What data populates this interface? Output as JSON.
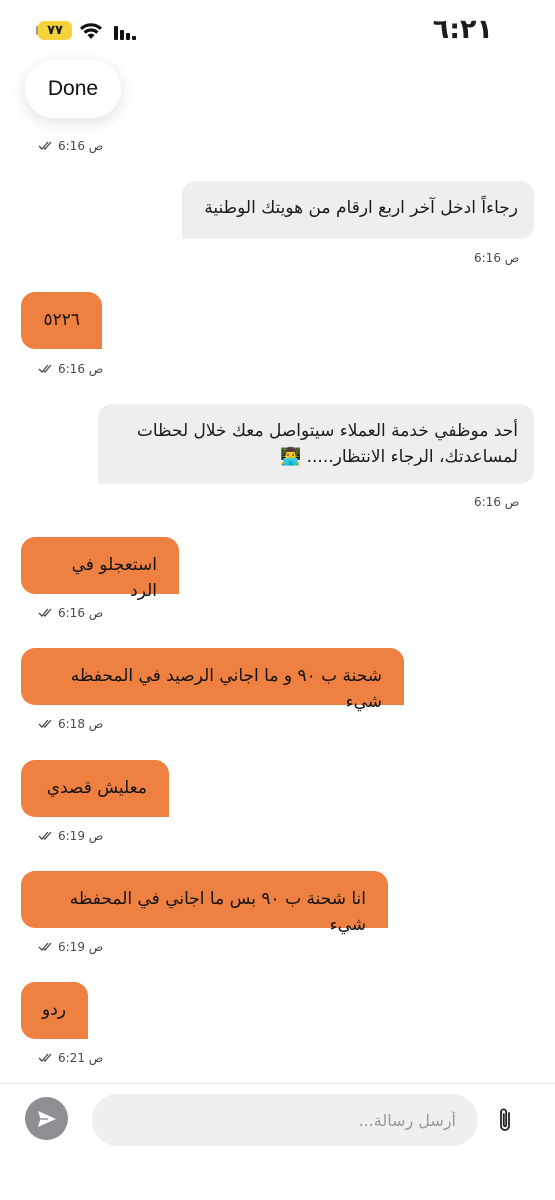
{
  "status_bar": {
    "time": "٦:٢١",
    "battery": "٧٧",
    "icons": [
      "battery-icon",
      "wifi-icon",
      "signal-icon"
    ]
  },
  "header": {
    "done_label": "Done",
    "first_timestamp": "6:16 ص"
  },
  "messages": [
    {
      "sender": "agent",
      "text": "رجاءاً ادخل آخر اربع ارقام من هويتك الوطنية",
      "time": "6:16 ص"
    },
    {
      "sender": "user",
      "text": "٥٢٢٦",
      "time": "6:16 ص"
    },
    {
      "sender": "agent",
      "text": "أحد موظفي خدمة العملاء سيتواصل معك خلال لحظات لمساعدتك، الرجاء الانتظار..... 👨‍💻",
      "time": "6:16 ص"
    },
    {
      "sender": "user",
      "text": "استعجلو في الرد",
      "time": "6:16 ص"
    },
    {
      "sender": "user",
      "text": "شحنة ب ٩٠ و ما اجاني الرصيد في المحفظه شيء",
      "time": "6:18 ص"
    },
    {
      "sender": "user",
      "text": "معليش قصدي",
      "time": "6:19 ص"
    },
    {
      "sender": "user",
      "text": "انا شحنة ب ٩٠ بس ما اجاني في المحفظه شيء",
      "time": "6:19 ص"
    },
    {
      "sender": "user",
      "text": "ردو",
      "time": "6:21 ص"
    }
  ],
  "composer": {
    "placeholder": "أرسل رسالة...",
    "send_icon": "send-icon",
    "attach_icon": "paperclip-icon"
  },
  "colors": {
    "user_bubble": "#ee8041",
    "agent_bubble": "#eeeeee",
    "battery": "#f6d33d",
    "send_button": "#8e8e93"
  }
}
